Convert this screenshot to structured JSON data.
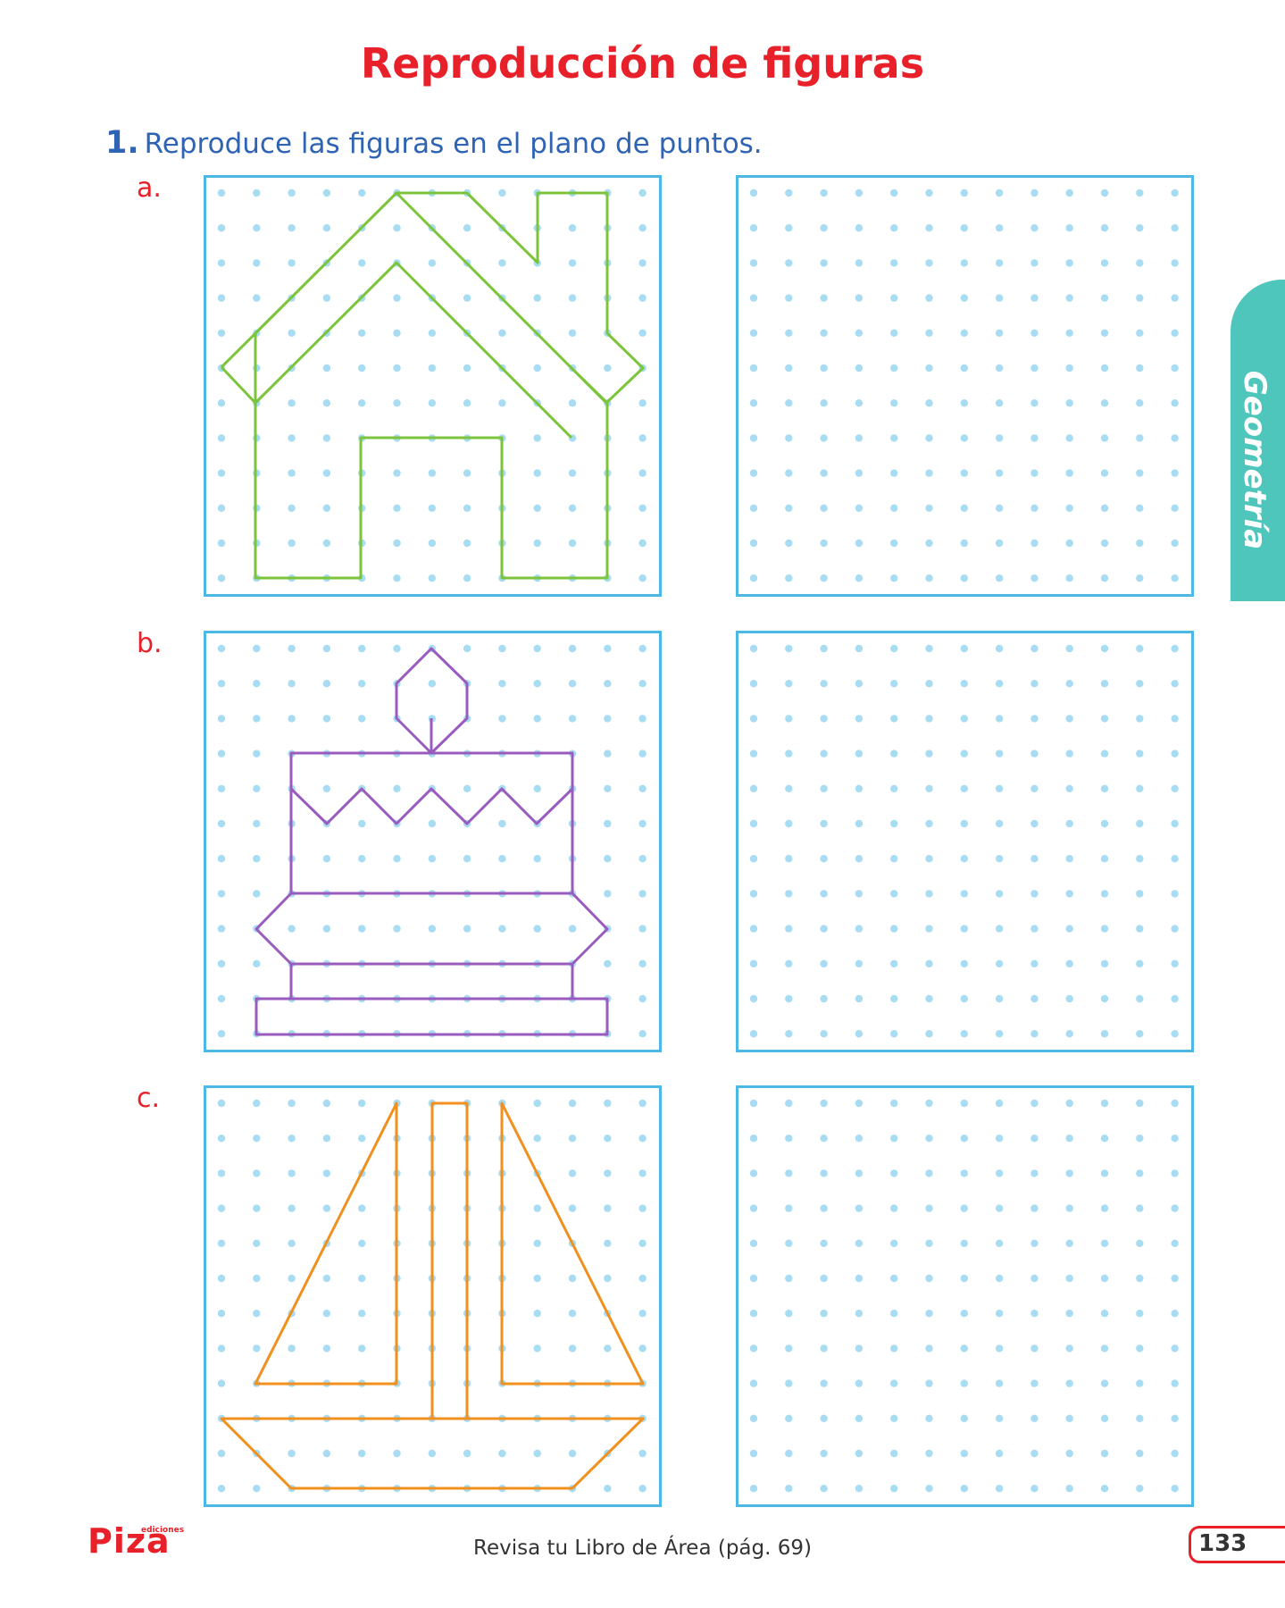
{
  "page": {
    "title": "Reproducción de figuras",
    "instruction_number": "1.",
    "instruction_text": "Reproduce las figuras en el plano de puntos."
  },
  "exercises": [
    {
      "label": "a.",
      "figure": "house-icon",
      "stroke_color": "#7cc43c"
    },
    {
      "label": "b.",
      "figure": "cake-icon",
      "stroke_color": "#9a5bbf"
    },
    {
      "label": "c.",
      "figure": "sailboat-icon",
      "stroke_color": "#f0901e"
    }
  ],
  "grid": {
    "columns": 13,
    "rows": 12,
    "dot_color": "#a8dcf2",
    "border_color": "#4bb8e6"
  },
  "side_tab": {
    "label": "Geometría",
    "color": "#4fc6bc"
  },
  "footer": {
    "reference": "Revisa tu Libro de Área (pág. 69)",
    "page_number": "133"
  },
  "brand": {
    "name": "Piza",
    "tagline": "ediciones"
  }
}
